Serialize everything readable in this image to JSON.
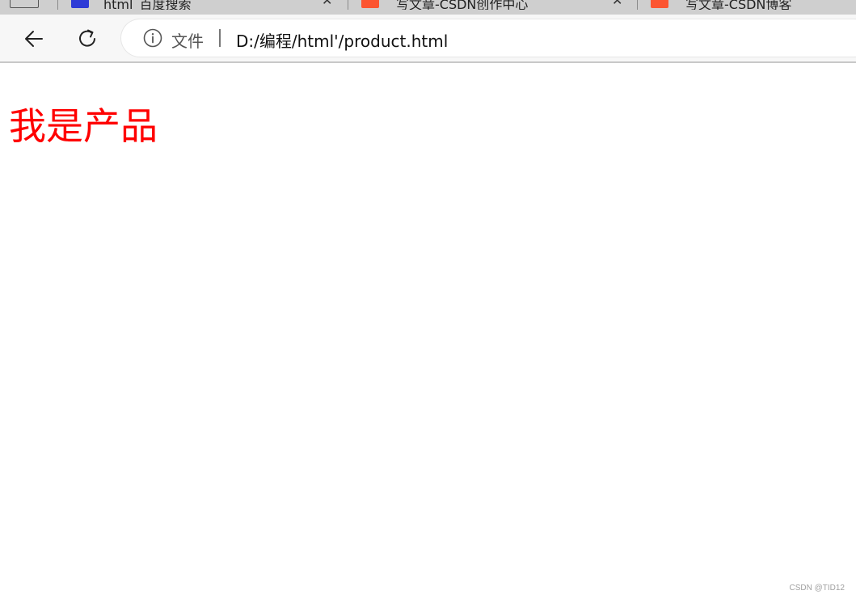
{
  "tabs": [
    {
      "favicon": "baidu-paw-icon",
      "title": "html_百度搜索",
      "close": "✕"
    },
    {
      "favicon": "csdn-logo-icon",
      "title": "写文章-CSDN创作中心",
      "close": "✕"
    },
    {
      "favicon": "csdn-logo-icon",
      "title": "写文章-CSDN博客",
      "close": ""
    }
  ],
  "toolbar": {
    "back_icon": "arrow-left-icon",
    "refresh_icon": "refresh-icon",
    "security_icon": "info-circle-icon",
    "security_label": "文件",
    "url": "D:/编程/html'/product.html"
  },
  "page": {
    "heading": "我是产品",
    "heading_color": "#ff0000"
  },
  "watermark": "CSDN @TID12"
}
